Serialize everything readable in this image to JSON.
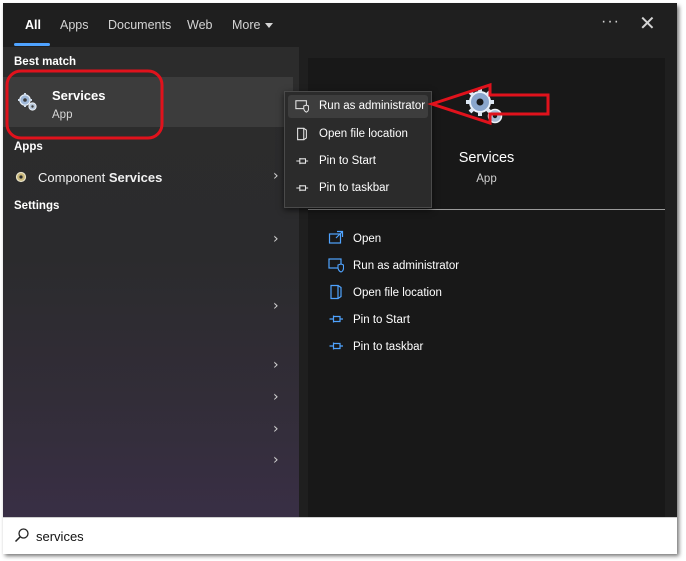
{
  "tabs": [
    {
      "label": "All"
    },
    {
      "label": "Apps"
    },
    {
      "label": "Documents"
    },
    {
      "label": "Web"
    },
    {
      "label": "More"
    }
  ],
  "window_controls": {
    "more_options": "···",
    "close": "✕"
  },
  "left": {
    "best_match_heading": "Best match",
    "best_match": {
      "title": "Services",
      "subtitle": "App",
      "icon": "gears-icon"
    },
    "apps_heading": "Apps",
    "apps": [
      {
        "label_prefix": "Component ",
        "label_bold": "Services",
        "icon": "component-services-icon"
      }
    ],
    "settings_heading": "Settings",
    "chevron": "›"
  },
  "context_menu": {
    "items": [
      {
        "label": "Run as administrator",
        "icon": "shield-window-icon",
        "highlighted": true
      },
      {
        "label": "Open file location",
        "icon": "folder-location-icon"
      },
      {
        "label": "Pin to Start",
        "icon": "pin-icon"
      },
      {
        "label": "Pin to taskbar",
        "icon": "pin-icon"
      }
    ]
  },
  "detail": {
    "title": "Services",
    "subtitle": "App",
    "actions": [
      {
        "label": "Open",
        "icon": "open-icon"
      },
      {
        "label": "Run as administrator",
        "icon": "shield-window-icon"
      },
      {
        "label": "Open file location",
        "icon": "folder-location-icon"
      },
      {
        "label": "Pin to Start",
        "icon": "pin-icon"
      },
      {
        "label": "Pin to taskbar",
        "icon": "pin-icon"
      }
    ]
  },
  "search": {
    "value": "services",
    "icon": "search-icon"
  },
  "colors": {
    "accent": "#4fa3ff",
    "annotation_red": "#e0121c"
  }
}
